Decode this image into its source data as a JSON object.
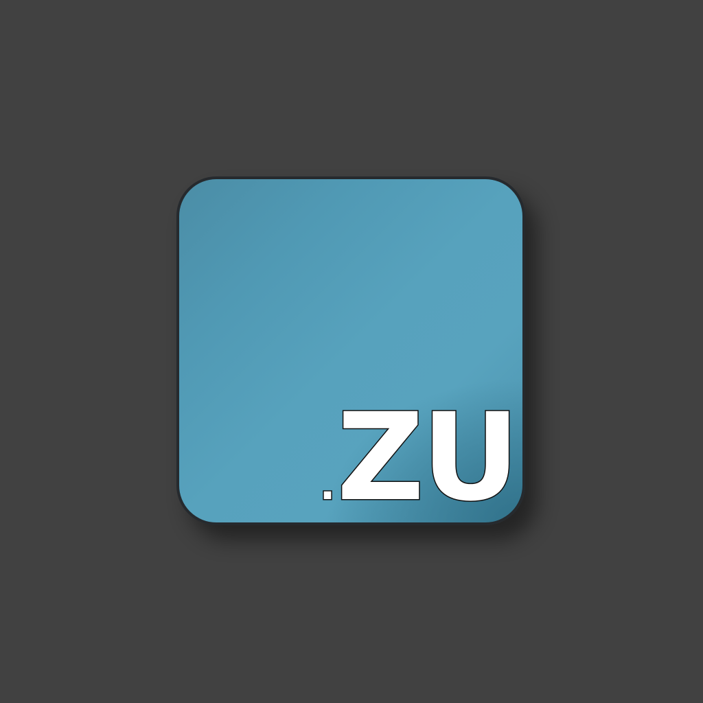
{
  "icon": {
    "extension_dot": ".",
    "extension_text": "ZU"
  },
  "colors": {
    "background": "#414141",
    "icon_fill": "#58a3be",
    "icon_border": "#262a2e",
    "label_fill": "#ffffff",
    "label_stroke": "#111111"
  }
}
